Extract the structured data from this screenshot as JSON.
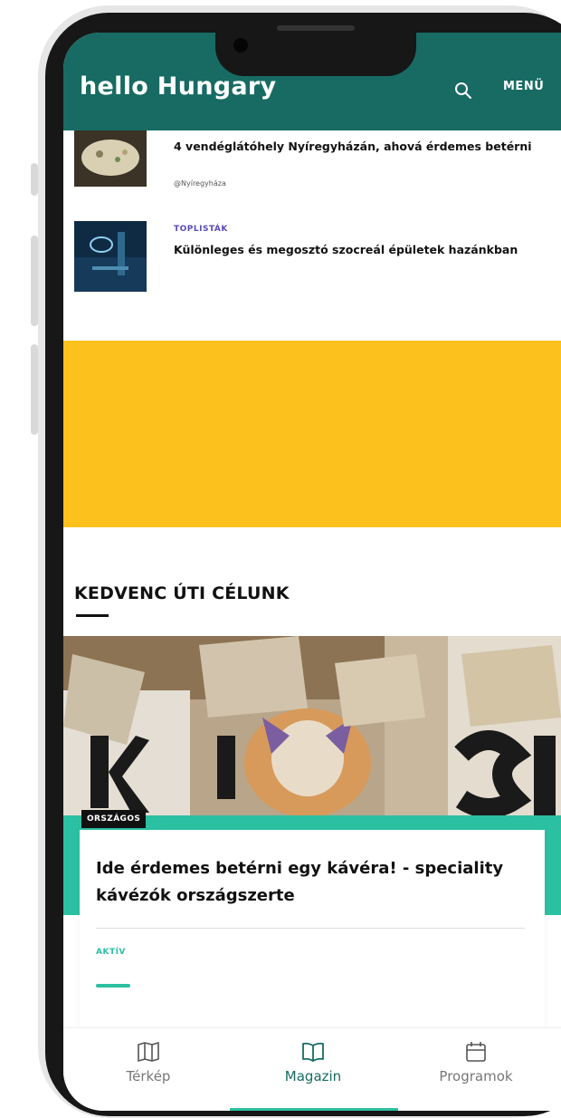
{
  "header": {
    "logo": "hello Hungary",
    "menu_label": "MENÜ"
  },
  "articles": [
    {
      "category": "",
      "title": "4 vendéglátóhely Nyíregyházán, ahová érdemes betérni",
      "meta": "@Nyíregyháza"
    },
    {
      "category": "TOPLISTÁK",
      "title": "Különleges és megosztó szocreál épületek hazánkban",
      "meta": ""
    }
  ],
  "section": {
    "title": "KEDVENC ÚTI CÉLUNK"
  },
  "feature": {
    "badge": "ORSZÁGOS",
    "title": "Ide érdemes betérni egy kávéra! - speciality kávézók országszerte",
    "tag": "AKTÍV"
  },
  "bottom_nav": [
    {
      "label": "Térkép",
      "icon": "map-icon",
      "active": false
    },
    {
      "label": "Magazin",
      "icon": "book-icon",
      "active": true
    },
    {
      "label": "Programok",
      "icon": "calendar-icon",
      "active": false
    }
  ],
  "colors": {
    "header": "#176b63",
    "accent": "#2bc0a2",
    "banner": "#fcc11d",
    "category": "#5a4bb7"
  }
}
